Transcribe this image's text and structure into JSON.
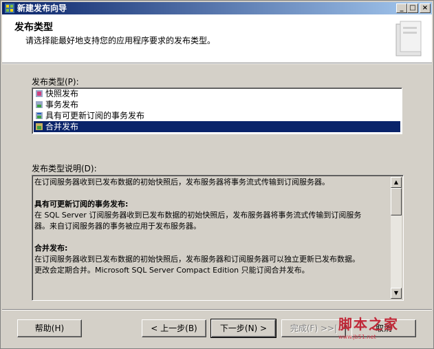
{
  "window": {
    "title": "新建发布向导",
    "min": "_",
    "max": "□",
    "close": "×"
  },
  "header": {
    "title": "发布类型",
    "subtitle": "请选择能最好地支持您的应用程序要求的发布类型。"
  },
  "publication_type": {
    "label": "发布类型(P):",
    "items": [
      {
        "label": "快照发布",
        "icon": "snapshot-publication-icon"
      },
      {
        "label": "事务发布",
        "icon": "transactional-publication-icon"
      },
      {
        "label": "具有可更新订阅的事务发布",
        "icon": "updatable-transactional-publication-icon"
      },
      {
        "label": "合并发布",
        "icon": "merge-publication-icon",
        "selected": true
      }
    ]
  },
  "description": {
    "label": "发布类型说明(D):",
    "line1": "在订阅服务器收到已发布数据的初始快照后，发布服务器将事务流式传输到订阅服务器。",
    "heading2": "具有可更新订阅的事务发布:",
    "line2a": "在 SQL Server 订阅服务器收到已发布数据的初始快照后，发布服务器将事务流式传输到订阅服务",
    "line2b": "器。来自订阅服务器的事务被应用于发布服务器。",
    "heading3": "合并发布:",
    "line3a": "在订阅服务器收到已发布数据的初始快照后，发布服务器和订阅服务器可以独立更新已发布数据。",
    "line3b": "更改会定期合并。Microsoft SQL Server Compact Edition 只能订阅合并发布。"
  },
  "buttons": {
    "help": "帮助(H)",
    "back": "< 上一步(B)",
    "next": "下一步(N) >",
    "finish": "完成(F) >>|",
    "cancel": "取消"
  },
  "watermark": {
    "text": "脚本之家",
    "sub": "www.jb51.net"
  }
}
